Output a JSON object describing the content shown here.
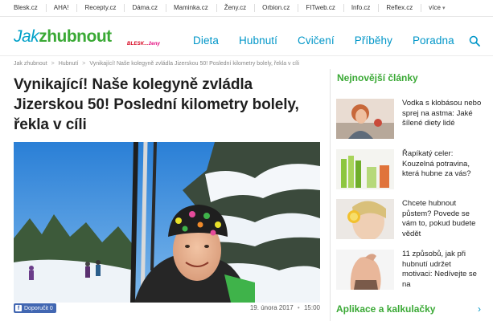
{
  "netbar": {
    "items": [
      "Blesk.cz",
      "AHA!",
      "Recepty.cz",
      "Dáma.cz",
      "Maminka.cz",
      "Ženy.cz",
      "Orbion.cz",
      "FITweb.cz",
      "Info.cz",
      "Reflex.cz",
      "více"
    ]
  },
  "header": {
    "logo_part1": "Jak",
    "logo_part2": "zhubnout",
    "partner_blesk": "BLESK",
    "partner_zeny": "ženy",
    "nav": [
      "Dieta",
      "Hubnutí",
      "Cvičení",
      "Příběhy",
      "Poradna"
    ]
  },
  "breadcrumb": {
    "home": "Jak zhubnout",
    "section": "Hubnutí",
    "current": "Vynikající! Naše kolegyně zvládla Jizerskou 50! Poslední kilometry bolely, řekla v cíli"
  },
  "article": {
    "title": "Vynikající! Naše kolegyně zvládla Jizerskou 50! Poslední kilometry bolely, řekla v cíli",
    "fb_label": "Doporučit 0",
    "fb_letter": "f",
    "date": "19. února 2017",
    "time": "15:00"
  },
  "sidebar": {
    "heading": "Nejnovější články",
    "news": [
      {
        "text": "Vodka s klobásou nebo sprej na astma: Jaké šílené diety lidé"
      },
      {
        "text": "Řapíkatý celer: Kouzelná potravina, která hubne za vás?"
      },
      {
        "text": "Chcete hubnout půstem? Povede se vám to, pokud budete vědět"
      },
      {
        "text": "11 způsobů, jak při hubnutí udržet motivaci: Nedívejte se na"
      }
    ],
    "footer": "Aplikace a kalkulačky",
    "footer_arrow": "›"
  },
  "colors": {
    "brand_blue": "#0096c8",
    "brand_green": "#3aa935",
    "facebook": "#4267b2"
  },
  "icons": [
    "search-icon",
    "facebook-icon",
    "chevron-down-icon",
    "chevron-right-icon"
  ]
}
